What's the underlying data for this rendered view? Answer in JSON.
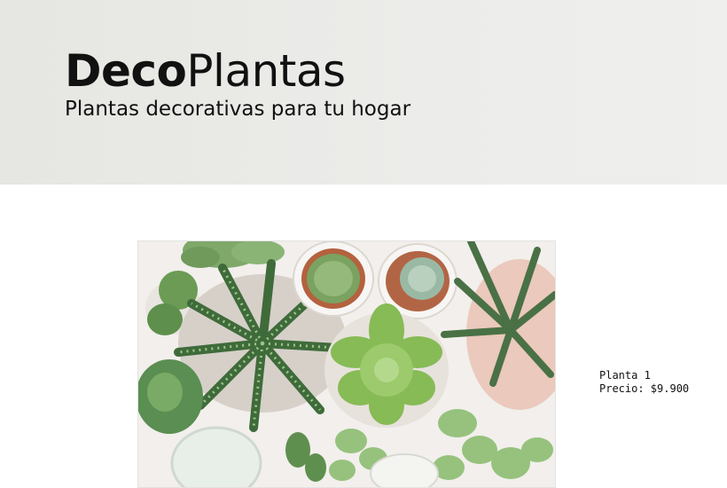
{
  "header": {
    "brand_bold": "Deco",
    "brand_light": "Plantas",
    "tagline": "Plantas decorativas para tu hogar"
  },
  "product": {
    "name": "Planta 1",
    "price": "Precio: $9.900",
    "image_icon": "succulents-photo"
  },
  "colors": {
    "header_bg": "#e9e9e6",
    "text": "#111111"
  }
}
